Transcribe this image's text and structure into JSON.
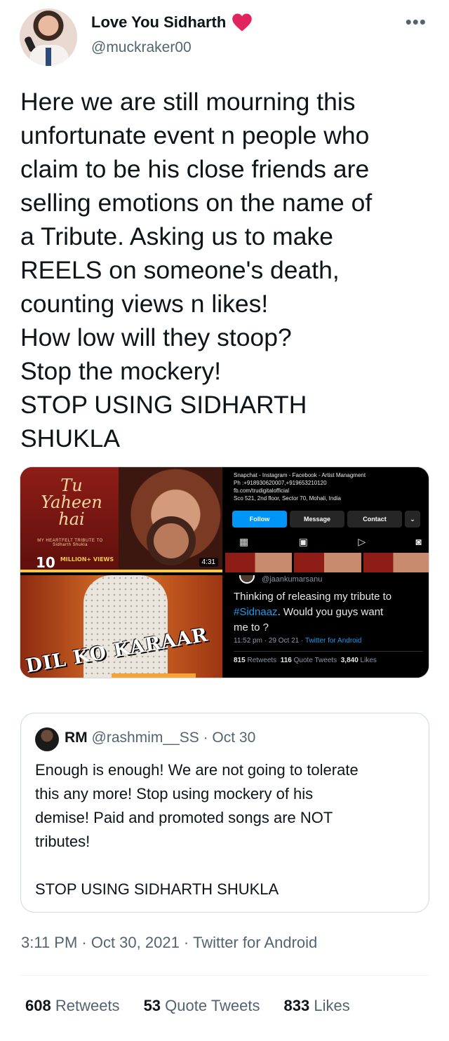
{
  "author": {
    "display_name": "Love You Sidharth",
    "handle": "@muckraker00",
    "heart_color": "#e0245e"
  },
  "more_icon": "more-horizontal-icon",
  "tweet": {
    "text": "Here we are still mourning this\nunfortunate event n people who\nclaim to be his close friends are\nselling emotions on the name of\na Tribute. Asking us to make\nREELS on someone's death,\ncounting views n likes!\nHow low will they stoop?\nStop the mockery!\nSTOP USING SIDHARTH\nSHUKLA"
  },
  "media": {
    "cover": {
      "title_line1": "Tu",
      "title_line2": "Yaheen",
      "title_line3": "hai",
      "subtitle": "MY HEARTFELT TRIBUTE TO Sidharth Shukla",
      "views_number": "10",
      "views_label": "MILLION+ VIEWS",
      "duration": "4:31"
    },
    "instagram": {
      "info": "Snapchat - Instagram - Facebook - Artist Managment\nPh :+918930620007,+919653210120\nfb.com/trudigitalofficial\nSco 521, 2nd floor, Sector 70, Mohali, India",
      "follow": "Follow",
      "message": "Message",
      "contact": "Contact"
    },
    "dil_ko_karaar": {
      "text": "DIL KO KARAAR"
    },
    "dark_tweet": {
      "handle": "@jaankumarsanu",
      "text_before": "Thinking of releasing my tribute to\n",
      "hashtag": "#Sidnaaz",
      "text_after": ". Would you guys want\nme to ?",
      "time": "11:52 pm · 29 Oct 21 · ",
      "source": "Twitter for Android",
      "retweets_count": "815",
      "retweets_label": "Retweets",
      "quotes_count": "116",
      "quotes_label": "Quote Tweets",
      "likes_count": "3,840",
      "likes_label": "Likes"
    }
  },
  "quote": {
    "name": "RM",
    "handle": "@rashmim__SS",
    "separator": "·",
    "date": "Oct 30",
    "text": "Enough is enough! We are not going to tolerate\nthis any more! Stop using mockery of his\ndemise! Paid and promoted songs are NOT\ntributes!\n\nSTOP USING SIDHARTH SHUKLA"
  },
  "meta": {
    "timestamp": "3:11 PM · Oct 30, 2021 · Twitter for Android"
  },
  "stats": {
    "retweets_count": "608",
    "retweets_label": "Retweets",
    "quotes_count": "53",
    "quotes_label": "Quote Tweets",
    "likes_count": "833",
    "likes_label": "Likes"
  }
}
